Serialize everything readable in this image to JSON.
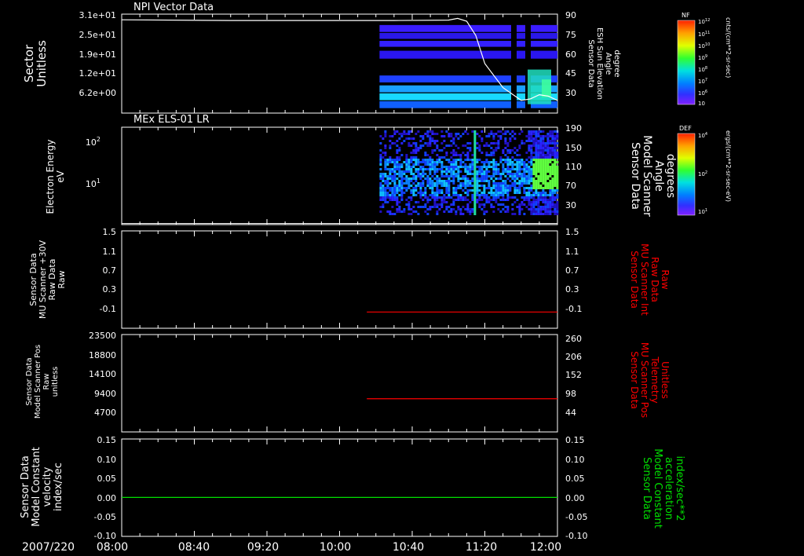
{
  "panels": {
    "p1": {
      "title": "NPI Vector Data",
      "left_label": [
        "Sector",
        "Unitless"
      ],
      "left_ticks": [
        "3.1e+01",
        "2.5e+01",
        "1.9e+01",
        "1.2e+01",
        "6.2e+00"
      ],
      "right_label": [
        "Sensor Data",
        "ESH Sun Elevation",
        "Angle",
        "degree"
      ],
      "right_ticks": [
        "90",
        "75",
        "60",
        "45",
        "30"
      ]
    },
    "p2": {
      "title": "MEx ELS-01 LR",
      "left_label": [
        "Electron Energy",
        "eV"
      ],
      "left_ticks": [
        "10",
        "10",
        "2",
        "1"
      ],
      "right_label": [
        "Sensor Data",
        "Model Scanner",
        "Angle",
        "degrees"
      ],
      "right_ticks": [
        "190",
        "150",
        "110",
        "70",
        "30"
      ]
    },
    "p3": {
      "left_label": [
        "Sensor Data",
        "MU Scanner +30V",
        "Raw Data",
        "Raw"
      ],
      "left_ticks": [
        "1.5",
        "1.1",
        "0.7",
        "0.3",
        "-0.1"
      ],
      "right_label": [
        "Sensor Data",
        "MU Scanner Int",
        "Raw Data",
        "Raw"
      ],
      "right_ticks": [
        "1.5",
        "1.1",
        "0.7",
        "0.3",
        "-0.1"
      ]
    },
    "p4": {
      "left_label": [
        "Sensor Data",
        "Model Scanner Pos",
        "Raw",
        "unitless"
      ],
      "left_ticks": [
        "23500",
        "18800",
        "14100",
        "9400",
        "4700"
      ],
      "right_label": [
        "Sensor Data",
        "MU Scanner Pos",
        "Telemetry",
        "Unitless"
      ],
      "right_ticks": [
        "260",
        "206",
        "152",
        "98",
        "44"
      ]
    },
    "p5": {
      "left_label": [
        "Sensor Data",
        "Model Constant",
        "velocity",
        "index/sec"
      ],
      "left_ticks": [
        "0.15",
        "0.10",
        "0.05",
        "0.00",
        "-0.05",
        "-0.10"
      ],
      "right_label": [
        "Sensor Data",
        "Model Constant",
        "acceleration",
        "index/sec**2"
      ],
      "right_ticks": [
        "0.15",
        "0.10",
        "0.05",
        "0.00",
        "-0.05",
        "-0.10"
      ]
    }
  },
  "time_axis": {
    "date": "2007/220",
    "ticks": [
      "08:00",
      "08:40",
      "09:20",
      "10:00",
      "10:40",
      "11:20",
      "12:00"
    ]
  },
  "colorbars": [
    {
      "name": "NF",
      "unit": "cnts/(cm**2-sr-sec)",
      "ticks": [
        "10",
        "10",
        "10",
        "10",
        "10",
        "10",
        "10",
        "10"
      ],
      "exps": [
        "12",
        "11",
        "10",
        "9",
        "8",
        "7",
        "6",
        ""
      ]
    },
    {
      "name": "DEF",
      "unit": "ergs/(cm**2-sr-sec-eV)",
      "ticks": [
        "10",
        "10",
        "10"
      ],
      "exps": [
        "4",
        "2",
        "1"
      ]
    }
  ],
  "colors": {
    "axis": "#ffffff",
    "red_trace": "#ff0000",
    "green_trace": "#00e000"
  },
  "chart_data": [
    {
      "type": "heatmap",
      "title": "NPI Vector Data",
      "ylabel": "Sector Unitless",
      "y2label": "Sensor Data ESH Sun Elevation Angle degree",
      "y2lim": [
        20,
        90
      ],
      "data_start": "10:22",
      "overlay_line": {
        "name": "ESH Sun Elevation Angle",
        "x": [
          "08:00",
          "09:00",
          "10:00",
          "10:30",
          "11:00",
          "11:05",
          "11:10",
          "11:15",
          "11:20",
          "11:30",
          "11:40",
          "11:45",
          "11:50",
          "11:55",
          "12:00"
        ],
        "y": [
          86,
          85.5,
          85.5,
          85.5,
          85.8,
          87,
          85,
          75,
          55,
          38,
          29,
          30,
          33,
          32,
          29
        ]
      }
    },
    {
      "type": "heatmap",
      "title": "MEx ELS-01 LR",
      "ylabel": "Electron Energy eV",
      "y2label": "Sensor Data Model Scanner Angle degrees",
      "y2lim": [
        10,
        190
      ],
      "data_start": "10:22",
      "overlay_line": {
        "name": "Model Scanner Angle",
        "x": [
          "08:00",
          "12:00"
        ],
        "y": [
          12,
          12
        ]
      }
    },
    {
      "type": "line",
      "ylabel": "Sensor Data MU Scanner +30V Raw Data Raw",
      "y2label": "Sensor Data MU Scanner Int Raw Data Raw",
      "ylim": [
        -0.3,
        1.5
      ],
      "series": [
        {
          "name": "MU Scanner Int Raw Data",
          "color": "#ff0000",
          "x": [
            "10:15",
            "12:00"
          ],
          "y": [
            0.0,
            0.0
          ]
        }
      ]
    },
    {
      "type": "line",
      "ylabel": "Sensor Data Model Scanner Pos Raw unitless",
      "y2label": "Sensor Data MU Scanner Pos Telemetry Unitless",
      "ylim": [
        0,
        23500
      ],
      "y2lim": [
        8,
        260
      ],
      "series": [
        {
          "name": "MU Scanner Pos Telemetry",
          "color": "#ff0000",
          "x": [
            "10:15",
            "12:00"
          ],
          "y": [
            8000,
            8000
          ]
        }
      ]
    },
    {
      "type": "line",
      "ylabel": "Sensor Data Model Constant velocity index/sec",
      "y2label": "Sensor Data Model Constant acceleration index/sec**2",
      "ylim": [
        -0.1,
        0.15
      ],
      "series": [
        {
          "name": "Model Constant acceleration",
          "color": "#00e000",
          "x": [
            "08:00",
            "12:00"
          ],
          "y": [
            0.0,
            0.0
          ]
        }
      ]
    }
  ]
}
